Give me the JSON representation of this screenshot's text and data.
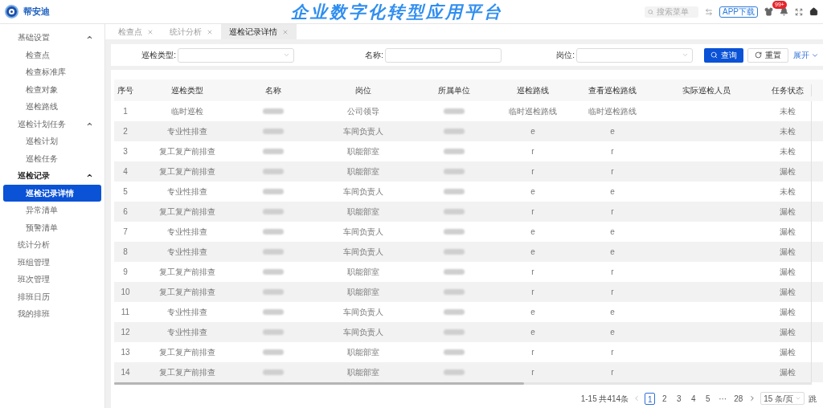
{
  "header": {
    "brand": "帮安迪",
    "title": "企业数字化转型应用平台",
    "search": {
      "placeholder": "搜索菜单"
    },
    "app_button": "APP下载",
    "notification_badge": "99+"
  },
  "sidebar": {
    "items": [
      {
        "label": "基础设置",
        "selected": false,
        "expanded": true,
        "children": [
          {
            "label": "检查点",
            "selected": false
          },
          {
            "label": "检查标准库",
            "selected": false
          },
          {
            "label": "检查对象",
            "selected": false
          },
          {
            "label": "巡检路线",
            "selected": false
          }
        ]
      },
      {
        "label": "巡检计划任务",
        "selected": false,
        "expanded": true,
        "children": [
          {
            "label": "巡检计划",
            "selected": false
          },
          {
            "label": "巡检任务",
            "selected": false
          }
        ]
      },
      {
        "label": "巡检记录",
        "selected": false,
        "expanded": true,
        "children": [
          {
            "label": "巡检记录详情",
            "selected": true
          },
          {
            "label": "异常清单",
            "selected": false
          },
          {
            "label": "预警清单",
            "selected": false
          }
        ]
      },
      {
        "label": "统计分析",
        "selected": false
      },
      {
        "label": "班组管理",
        "selected": false
      },
      {
        "label": "班次管理",
        "selected": false
      },
      {
        "label": "排班日历",
        "selected": false
      },
      {
        "label": "我的排班",
        "selected": false
      }
    ]
  },
  "tabs": [
    {
      "label": "检查点",
      "selected": false
    },
    {
      "label": "统计分析",
      "selected": false
    },
    {
      "label": "巡检记录详情",
      "selected": true
    }
  ],
  "filters": {
    "fields": [
      {
        "label": "巡检类型:",
        "kind": "select"
      },
      {
        "label": "名称:",
        "kind": "input"
      },
      {
        "label": "岗位:",
        "kind": "select"
      }
    ],
    "search_button": "查询",
    "reset_button": "重置",
    "expand_link": "展开"
  },
  "table": {
    "columns": [
      "序号",
      "巡检类型",
      "名称",
      "岗位",
      "所属单位",
      "巡检路线",
      "查看巡检路线",
      "实际巡检人员",
      "任务状态"
    ],
    "rows": [
      {
        "no": "1",
        "type": "临时巡检",
        "post": "公司领导",
        "route": "临时巡检路线",
        "view_route": "临时巡检路线",
        "status": "未检"
      },
      {
        "no": "2",
        "type": "专业性排查",
        "post": "车间负责人",
        "route": "e",
        "view_route": "e",
        "status": "未检"
      },
      {
        "no": "3",
        "type": "复工复产前排查",
        "post": "职能部室",
        "route": "r",
        "view_route": "r",
        "status": "未检"
      },
      {
        "no": "4",
        "type": "复工复产前排查",
        "post": "职能部室",
        "route": "r",
        "view_route": "r",
        "status": "漏检"
      },
      {
        "no": "5",
        "type": "专业性排查",
        "post": "车间负责人",
        "route": "e",
        "view_route": "e",
        "status": "未检"
      },
      {
        "no": "6",
        "type": "复工复产前排查",
        "post": "职能部室",
        "route": "r",
        "view_route": "r",
        "status": "漏检"
      },
      {
        "no": "7",
        "type": "专业性排查",
        "post": "车间负责人",
        "route": "e",
        "view_route": "e",
        "status": "漏检"
      },
      {
        "no": "8",
        "type": "专业性排查",
        "post": "车间负责人",
        "route": "e",
        "view_route": "e",
        "status": "漏检"
      },
      {
        "no": "9",
        "type": "复工复产前排查",
        "post": "职能部室",
        "route": "r",
        "view_route": "r",
        "status": "漏检"
      },
      {
        "no": "10",
        "type": "复工复产前排查",
        "post": "职能部室",
        "route": "r",
        "view_route": "r",
        "status": "漏检"
      },
      {
        "no": "11",
        "type": "专业性排查",
        "post": "车间负责人",
        "route": "e",
        "view_route": "e",
        "status": "漏检"
      },
      {
        "no": "12",
        "type": "专业性排查",
        "post": "车间负责人",
        "route": "e",
        "view_route": "e",
        "status": "漏检"
      },
      {
        "no": "13",
        "type": "复工复产前排查",
        "post": "职能部室",
        "route": "r",
        "view_route": "r",
        "status": "漏检"
      },
      {
        "no": "14",
        "type": "复工复产前排查",
        "post": "职能部室",
        "route": "r",
        "view_route": "r",
        "status": "漏检"
      }
    ]
  },
  "pagination": {
    "summary": "1-15 共414条",
    "pages": [
      {
        "label": "1",
        "selected": true
      },
      {
        "label": "2",
        "selected": false
      },
      {
        "label": "3",
        "selected": false
      },
      {
        "label": "4",
        "selected": false
      },
      {
        "label": "5",
        "selected": false
      },
      {
        "label": "···",
        "selected": false
      },
      {
        "label": "28",
        "selected": false
      }
    ],
    "page_size": "15 条/页",
    "jump": "跳"
  }
}
